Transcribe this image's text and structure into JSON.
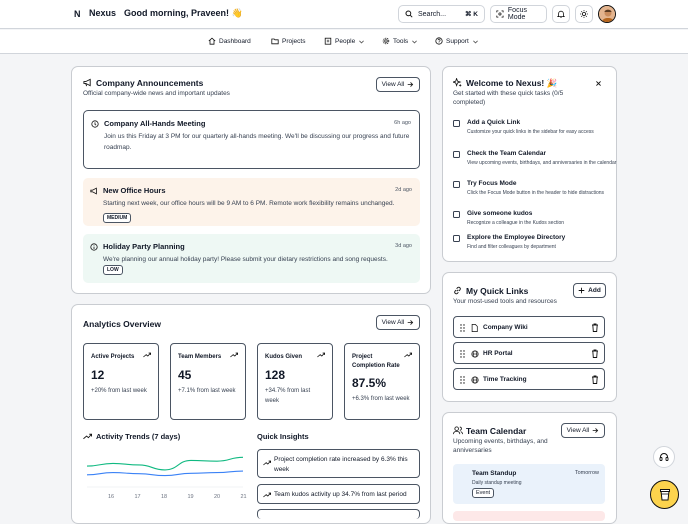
{
  "header": {
    "logo": "N",
    "app_name": "Nexus",
    "greeting": "Good morning, Praveen! 👋",
    "search_label": "Search...",
    "search_shortcut": "⌘ K",
    "focus_label": "Focus Mode"
  },
  "nav": {
    "items": [
      {
        "label": "Dashboard",
        "icon": "home-icon"
      },
      {
        "label": "Projects",
        "icon": "folder-icon"
      },
      {
        "label": "People",
        "icon": "building-icon"
      },
      {
        "label": "Tools",
        "icon": "gear-icon"
      },
      {
        "label": "Support",
        "icon": "help-circle-icon"
      }
    ]
  },
  "announcements": {
    "title": "Company Announcements",
    "subtitle": "Official company-wide news and important updates",
    "view_all": "View All",
    "items": [
      {
        "title": "Company All-Hands Meeting",
        "time": "6h ago",
        "body": "Join us this Friday at 3 PM for our quarterly all-hands meeting. We'll be discussing our progress and future roadmap.",
        "badge": "",
        "icon": "info-icon"
      },
      {
        "title": "New Office Hours",
        "time": "2d ago",
        "body": "Starting next week, our office hours will be 9 AM to 6 PM. Remote work flexibility remains unchanged.",
        "badge": "MEDIUM",
        "icon": "megaphone-icon"
      },
      {
        "title": "Holiday Party Planning",
        "time": "3d ago",
        "body": "We're planning our annual holiday party! Please submit your dietary restrictions and song requests.",
        "badge": "LOW",
        "icon": "info-icon"
      }
    ]
  },
  "analytics": {
    "title": "Analytics Overview",
    "view_all": "View All",
    "stats": [
      {
        "label": "Active Projects",
        "value": "12",
        "delta": "+20% from last week"
      },
      {
        "label": "Team Members",
        "value": "45",
        "delta": "+7.1% from last week"
      },
      {
        "label": "Kudos Given",
        "value": "128",
        "delta": "+34.7% from last week"
      },
      {
        "label": "Project Completion Rate",
        "value": "87.5%",
        "delta": "+6.3% from last week"
      }
    ],
    "trends_title": "Activity Trends (7 days)",
    "insights_title": "Quick Insights",
    "insights": [
      "Project completion rate increased by 6.3% this week",
      "Team kudos activity up 34.7% from last period"
    ]
  },
  "chart_data": {
    "type": "line",
    "x": [
      "16",
      "17",
      "18",
      "19",
      "20",
      "21"
    ],
    "series": [
      {
        "values": [
          0.55,
          0.62,
          0.58,
          0.45,
          0.7,
          0.68,
          0.78
        ]
      },
      {
        "values": [
          0.32,
          0.38,
          0.35,
          0.3,
          0.36,
          0.38,
          0.42
        ]
      }
    ],
    "colors": [
      "#10b981",
      "#3b82f6"
    ]
  },
  "welcome": {
    "title": "Welcome to Nexus! 🎉",
    "subtitle": "Get started with these quick tasks (0/5 completed)",
    "tasks": [
      {
        "title": "Add a Quick Link",
        "desc": "Customize your quick links in the sidebar for easy access"
      },
      {
        "title": "Check the Team Calendar",
        "desc": "View upcoming events, birthdays, and anniversaries in the calendar"
      },
      {
        "title": "Try Focus Mode",
        "desc": "Click the Focus Mode button in the header to hide distractions"
      },
      {
        "title": "Give someone kudos",
        "desc": "Recognize a colleague in the Kudos section"
      },
      {
        "title": "Explore the Employee Directory",
        "desc": "Find and filter colleagues by department"
      }
    ]
  },
  "quick_links": {
    "title": "My Quick Links",
    "subtitle": "Your most-used tools and resources",
    "add_label": "Add",
    "items": [
      {
        "label": "Company Wiki",
        "icon": "file-icon"
      },
      {
        "label": "HR Portal",
        "icon": "globe-icon"
      },
      {
        "label": "Time Tracking",
        "icon": "globe-icon"
      }
    ]
  },
  "calendar": {
    "title": "Team Calendar",
    "subtitle": "Upcoming events, birthdays, and anniversaries",
    "view_all": "View All",
    "event": {
      "title": "Team Standup",
      "subtitle": "Daily standup meeting",
      "when": "Tomorrow",
      "tag": "Event"
    }
  }
}
